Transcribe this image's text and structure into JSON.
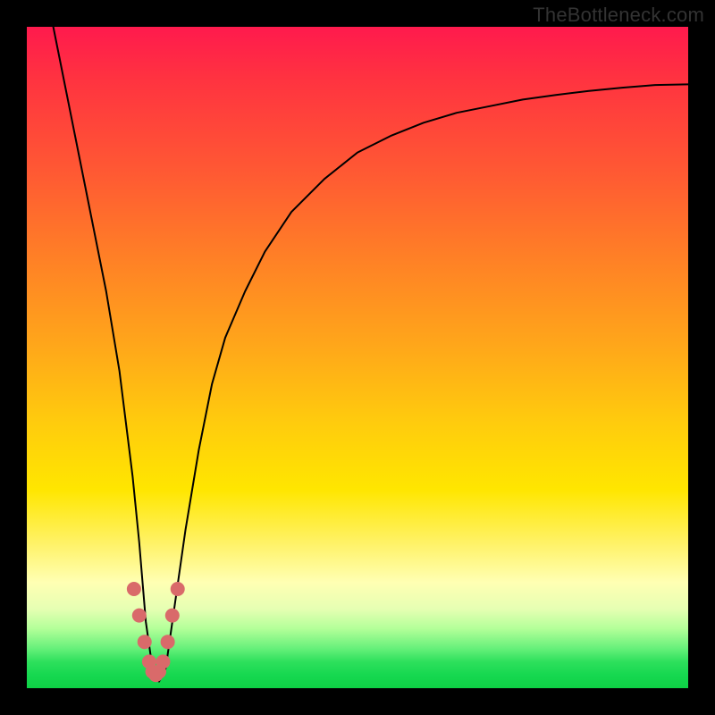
{
  "watermark": "TheBottleneck.com",
  "chart_data": {
    "type": "line",
    "title": "",
    "xlabel": "",
    "ylabel": "",
    "xlim": [
      0,
      100
    ],
    "ylim": [
      0,
      100
    ],
    "grid": false,
    "legend": false,
    "background_gradient": {
      "direction": "vertical",
      "stops": [
        {
          "pos": 0.0,
          "color": "#ff1a4d"
        },
        {
          "pos": 0.35,
          "color": "#ff8026"
        },
        {
          "pos": 0.7,
          "color": "#ffe600"
        },
        {
          "pos": 0.88,
          "color": "#e6ffb3"
        },
        {
          "pos": 1.0,
          "color": "#0ed145"
        }
      ]
    },
    "series": [
      {
        "name": "bottleneck-curve",
        "stroke": "#000000",
        "stroke_width": 2,
        "x": [
          4,
          6,
          8,
          10,
          12,
          14,
          16,
          17,
          18,
          19,
          20,
          21,
          22,
          24,
          26,
          28,
          30,
          33,
          36,
          40,
          45,
          50,
          55,
          60,
          65,
          70,
          75,
          80,
          85,
          90,
          95,
          100
        ],
        "y": [
          100,
          90,
          80,
          70,
          60,
          48,
          32,
          22,
          10,
          3,
          1,
          3,
          10,
          24,
          36,
          46,
          53,
          60,
          66,
          72,
          77,
          81,
          83.5,
          85.5,
          87,
          88,
          89,
          89.7,
          90.3,
          90.8,
          91.2,
          91.3
        ]
      },
      {
        "name": "marker-band",
        "type": "scatter",
        "marker_color": "#d96a6a",
        "marker_radius": 8,
        "x": [
          16.2,
          17.0,
          17.8,
          18.5,
          19.0,
          19.5,
          20.0,
          20.6,
          21.3,
          22.0,
          22.8
        ],
        "y": [
          15,
          11,
          7,
          4,
          2.5,
          2,
          2.5,
          4,
          7,
          11,
          15
        ]
      }
    ]
  }
}
